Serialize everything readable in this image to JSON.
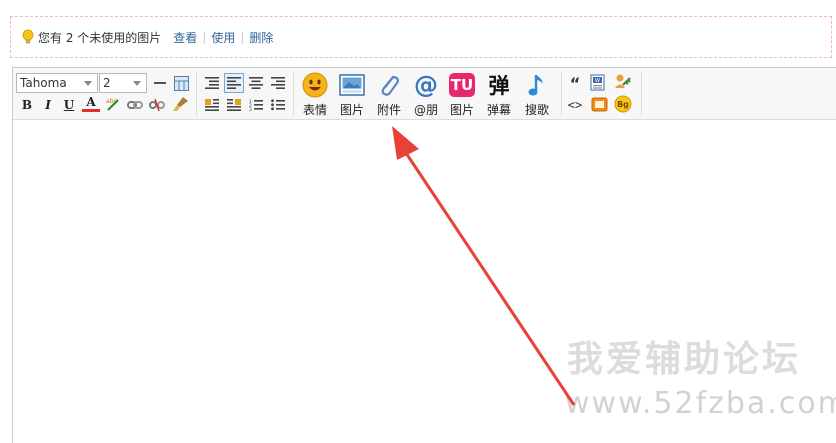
{
  "notice": {
    "text": "您有 2 个未使用的图片",
    "view_label": "查看",
    "use_label": "使用",
    "delete_label": "删除",
    "separator": "|"
  },
  "toolbar": {
    "font_family": "Tahoma",
    "font_size": "2",
    "format_buttons": {
      "bold": "B",
      "italic": "I",
      "underline": "U",
      "font_color": "A"
    },
    "insert_buttons": [
      {
        "icon": "smiley-icon",
        "label": "表情"
      },
      {
        "icon": "image-icon",
        "label": "图片"
      },
      {
        "icon": "paperclip-icon",
        "label": "附件"
      },
      {
        "icon": "at-icon",
        "label": "@朋"
      },
      {
        "icon": "tu-image-icon",
        "label": "图片",
        "glyph": "TU"
      },
      {
        "icon": "danmaku-icon",
        "label": "弹幕",
        "glyph": "弹"
      },
      {
        "icon": "music-note-icon",
        "label": "搜歌"
      }
    ],
    "extra_buttons": {
      "quote_glyph": "“",
      "code_glyph": "<>",
      "bg_glyph": "Bg"
    }
  },
  "watermark": {
    "title": "我爱辅助论坛",
    "url": "www.52fzba.com"
  },
  "colors": {
    "notice_border": "#f2b8b8",
    "link": "#336699",
    "arrow": "#e8413a",
    "toolbar_bg": "#f7f7f7"
  }
}
